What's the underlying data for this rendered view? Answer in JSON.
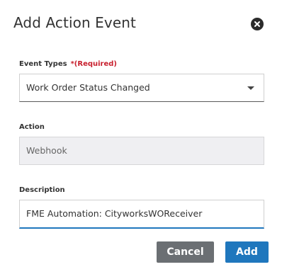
{
  "dialog": {
    "title": "Add Action Event",
    "close_icon": "close-circle-icon"
  },
  "event_types": {
    "label": "Event Types",
    "required_text": "*(Required)",
    "selected_value": "Work Order Status Changed",
    "caret_icon": "chevron-down-icon"
  },
  "action": {
    "label": "Action",
    "value": "Webhook"
  },
  "description": {
    "label": "Description",
    "value": "FME Automation: CityworksWOReceiver"
  },
  "buttons": {
    "cancel_label": "Cancel",
    "add_label": "Add"
  },
  "colors": {
    "primary": "#1f77bd",
    "cancel": "#6b6f73",
    "required": "#c8202e"
  }
}
